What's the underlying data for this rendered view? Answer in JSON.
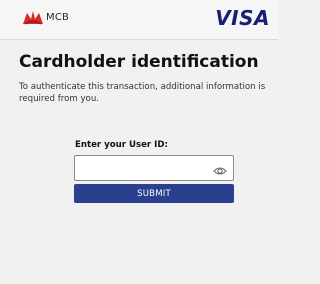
{
  "header": {
    "bank_name": "MCB",
    "bank_logo_icon": "mcb-logo-icon",
    "card_brand": "VISA",
    "colors": {
      "visa_blue": "#1a1f71",
      "mcb_red": "#d42a2a"
    }
  },
  "main": {
    "title": "Cardholder identification",
    "description": "To authenticate this transaction, additional information is required from you."
  },
  "form": {
    "user_id_label": "Enter your User ID:",
    "user_id_value": "",
    "user_id_placeholder": "",
    "show_password_icon": "eye-icon",
    "submit_label": "SUBMIT",
    "submit_color": "#2b3f8f"
  }
}
